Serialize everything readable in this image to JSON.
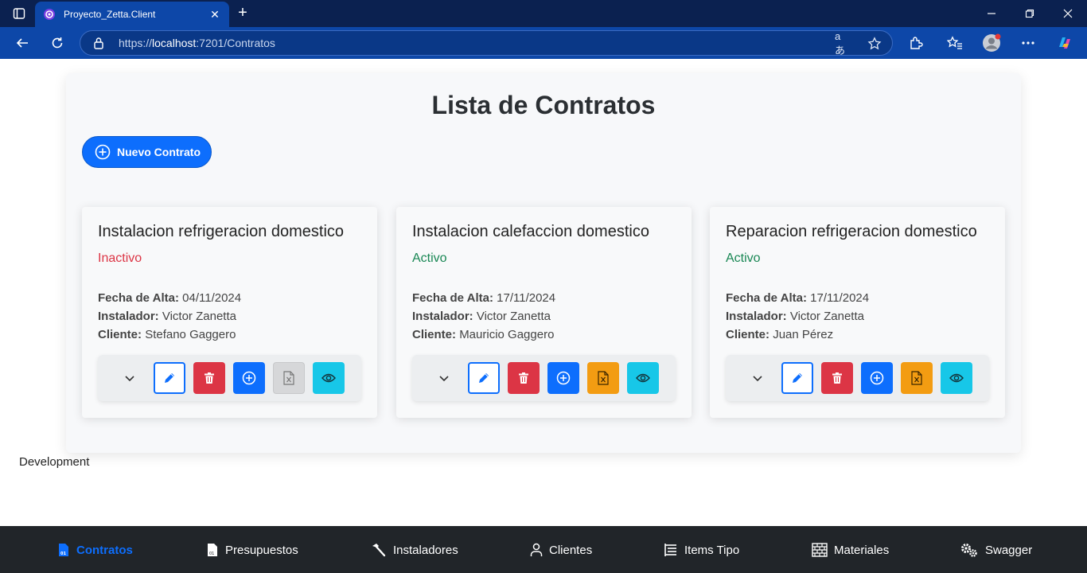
{
  "browser": {
    "tab_title": "Proyecto_Zetta.Client",
    "url_scheme": "https://",
    "url_host": "localhost",
    "url_rest": ":7201/Contratos",
    "accent": "#0d47a8"
  },
  "page": {
    "title": "Lista de Contratos",
    "new_button": "Nuevo Contrato",
    "env_label": "Development"
  },
  "labels": {
    "fecha": "Fecha de Alta:",
    "instalador": "Instalador:",
    "cliente": "Cliente:"
  },
  "cards": [
    {
      "title": "Instalacion refrigeracion domestico",
      "status": "Inactivo",
      "fecha": "04/11/2024",
      "instalador": "Victor Zanetta",
      "cliente": "Stefano Gaggero",
      "pdf_enabled": false
    },
    {
      "title": "Instalacion calefaccion domestico",
      "status": "Activo",
      "fecha": "17/11/2024",
      "instalador": "Victor Zanetta",
      "cliente": "Mauricio Gaggero",
      "pdf_enabled": true
    },
    {
      "title": "Reparacion refrigeracion domestico",
      "status": "Activo",
      "fecha": "17/11/2024",
      "instalador": "Victor Zanetta",
      "cliente": "Juan Pérez",
      "pdf_enabled": true
    }
  ],
  "nav": [
    {
      "label": "Contratos",
      "icon": "contract-icon",
      "active": true
    },
    {
      "label": "Presupuestos",
      "icon": "budget-icon",
      "active": false
    },
    {
      "label": "Instaladores",
      "icon": "hammer-icon",
      "active": false
    },
    {
      "label": "Clientes",
      "icon": "person-icon",
      "active": false
    },
    {
      "label": "Items Tipo",
      "icon": "list-tree-icon",
      "active": false
    },
    {
      "label": "Materiales",
      "icon": "bricks-icon",
      "active": false
    },
    {
      "label": "Swagger",
      "icon": "gears-icon",
      "active": false
    }
  ],
  "colors": {
    "primary": "#0d6efd",
    "danger": "#dc3545",
    "success": "#198754",
    "warning": "#f39c12",
    "info": "#17c7e8",
    "nav_bg": "#212529"
  }
}
